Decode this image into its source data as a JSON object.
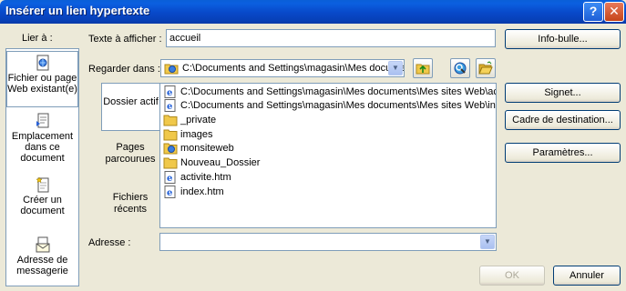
{
  "window": {
    "title": "Insérer un lien hypertexte",
    "help_glyph": "?",
    "close_glyph": "✕"
  },
  "left": {
    "label": "Lier à :",
    "items": [
      {
        "label": "Fichier ou page Web existant(e)",
        "icon": "web-page-icon"
      },
      {
        "label": "Emplacement dans ce document",
        "icon": "document-location-icon"
      },
      {
        "label": "Créer un document",
        "icon": "new-document-icon"
      },
      {
        "label": "Adresse de messagerie",
        "icon": "email-icon"
      }
    ]
  },
  "text_to_display": {
    "label": "Texte à afficher :",
    "value": "accueil"
  },
  "screentip_button": "Info-bulle...",
  "look_in": {
    "label": "Regarder dans :",
    "value": "C:\\Documents and Settings\\magasin\\Mes documents\\Mes sites Web\\accueil"
  },
  "tabs": [
    {
      "label": "Dossier actif"
    },
    {
      "label": "Pages parcourues"
    },
    {
      "label": "Fichiers récents"
    }
  ],
  "files": [
    {
      "name": "C:\\Documents and Settings\\magasin\\Mes documents\\Mes sites Web\\accueil.htm",
      "icon": "ie-page-icon"
    },
    {
      "name": "C:\\Documents and Settings\\magasin\\Mes documents\\Mes sites Web\\index.htm",
      "icon": "ie-page-icon"
    },
    {
      "name": "_private",
      "icon": "folder-icon"
    },
    {
      "name": "images",
      "icon": "folder-icon"
    },
    {
      "name": "monsiteweb",
      "icon": "web-folder-icon"
    },
    {
      "name": "Nouveau_Dossier",
      "icon": "folder-icon"
    },
    {
      "name": "activite.htm",
      "icon": "ie-page-icon"
    },
    {
      "name": "index.htm",
      "icon": "ie-page-icon"
    }
  ],
  "right_buttons": {
    "bookmark": "Signet...",
    "target_frame": "Cadre de destination...",
    "parameters": "Paramètres..."
  },
  "address": {
    "label": "Adresse :",
    "value": ""
  },
  "footer": {
    "ok": "OK",
    "cancel": "Annuler"
  }
}
